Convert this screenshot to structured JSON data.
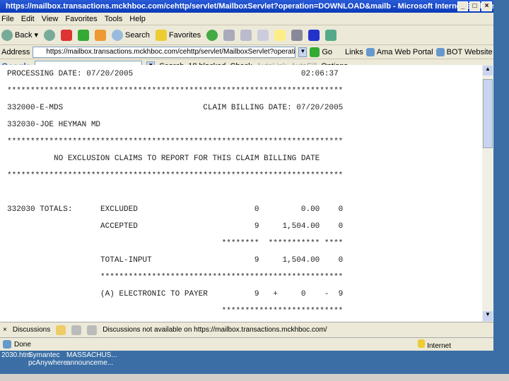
{
  "window": {
    "title": "https://mailbox.transactions.mckhboc.com/cehttp/servlet/MailboxServlet?operation=DOWNLOAD&mailb - Microsoft Internet Explorer p"
  },
  "menu": [
    "File",
    "Edit",
    "View",
    "Favorites",
    "Tools",
    "Help"
  ],
  "toolbar": {
    "back": "Back",
    "search": "Search",
    "favorites": "Favorites"
  },
  "address": {
    "label": "Address",
    "value": "https://mailbox.transactions.mckhboc.com/cehttp/servlet/MailboxServlet?operation=DOWNLOAD&ma",
    "go": "Go",
    "links": "Links",
    "link1": "Ama Web Portal",
    "link2": "BOT Website"
  },
  "google": {
    "logo": "Google",
    "search": "Search",
    "blocked": "18 blocked",
    "check": "Check",
    "autolink": "AutoLink",
    "autofill": "AutoFill",
    "options": "Options"
  },
  "report": {
    "lines": [
      "PROCESSING DATE: 07/20/2005                                    02:06:37",
      "************************************************************************",
      "332000-E-MDS                              CLAIM BILLING DATE: 07/20/2005",
      "332030-JOE HEYMAN MD",
      "************************************************************************",
      "          NO EXCLUSION CLAIMS TO REPORT FOR THIS CLAIM BILLING DATE",
      "************************************************************************",
      "",
      "332030 TOTALS:      EXCLUDED                         0         0.00    0",
      "                    ACCEPTED                         9     1,504.00    0",
      "                                              ********  *********** ****",
      "                    TOTAL-INPUT                      9     1,504.00    0",
      "                    ****************************************************",
      "                    (A) ELECTRONIC TO PAYER          9   +     0    -  9",
      "                                              **************************"
    ]
  },
  "discussions": {
    "label": "Discussions",
    "message": "Discussions not available on https://mailbox.transactions.mckhboc.com/"
  },
  "status": {
    "text": "Done",
    "zone": "Internet"
  },
  "desktop": [
    {
      "label1": "2030.htm",
      "label2": ""
    },
    {
      "label1": "Symantec",
      "label2": "pcAnywhere"
    },
    {
      "label1": "MASSACHUS...",
      "label2": "announceme..."
    }
  ]
}
